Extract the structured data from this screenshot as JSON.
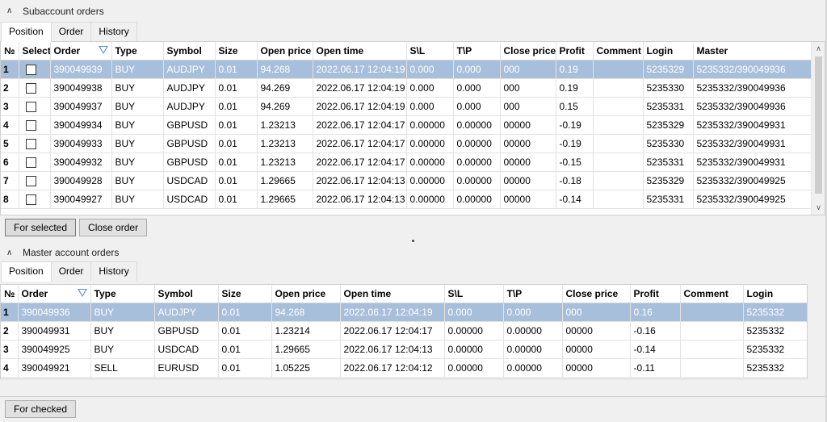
{
  "sub": {
    "header": "Subaccount orders",
    "tabs": [
      "Position",
      "Order",
      "History"
    ],
    "columns": [
      "№",
      "Select",
      "Order",
      "Type",
      "Symbol",
      "Size",
      "Open price",
      "Open time",
      "S\\L",
      "T\\P",
      "Close price",
      "Profit",
      "Comment",
      "Login",
      "Master"
    ],
    "rows": [
      [
        "1",
        "",
        "390049939",
        "BUY",
        "AUDJPY",
        "0.01",
        "94.268",
        "2022.06.17 12:04:19",
        "0.000",
        "0.000",
        "000",
        "0.19",
        "",
        "5235329",
        "5235332/390049936"
      ],
      [
        "2",
        "",
        "390049938",
        "BUY",
        "AUDJPY",
        "0.01",
        "94.269",
        "2022.06.17 12:04:19",
        "0.000",
        "0.000",
        "000",
        "0.19",
        "",
        "5235330",
        "5235332/390049936"
      ],
      [
        "3",
        "",
        "390049937",
        "BUY",
        "AUDJPY",
        "0.01",
        "94.269",
        "2022.06.17 12:04:19",
        "0.000",
        "0.000",
        "000",
        "0.15",
        "",
        "5235331",
        "5235332/390049936"
      ],
      [
        "4",
        "",
        "390049934",
        "BUY",
        "GBPUSD",
        "0.01",
        "1.23213",
        "2022.06.17 12:04:17",
        "0.00000",
        "0.00000",
        "00000",
        "-0.19",
        "",
        "5235329",
        "5235332/390049931"
      ],
      [
        "5",
        "",
        "390049933",
        "BUY",
        "GBPUSD",
        "0.01",
        "1.23213",
        "2022.06.17 12:04:17",
        "0.00000",
        "0.00000",
        "00000",
        "-0.19",
        "",
        "5235330",
        "5235332/390049931"
      ],
      [
        "6",
        "",
        "390049932",
        "BUY",
        "GBPUSD",
        "0.01",
        "1.23213",
        "2022.06.17 12:04:17",
        "0.00000",
        "0.00000",
        "00000",
        "-0.15",
        "",
        "5235331",
        "5235332/390049931"
      ],
      [
        "7",
        "",
        "390049928",
        "BUY",
        "USDCAD",
        "0.01",
        "1.29665",
        "2022.06.17 12:04:13",
        "0.00000",
        "0.00000",
        "00000",
        "-0.18",
        "",
        "5235329",
        "5235332/390049925"
      ],
      [
        "8",
        "",
        "390049927",
        "BUY",
        "USDCAD",
        "0.01",
        "1.29665",
        "2022.06.17 12:04:13",
        "0.00000",
        "0.00000",
        "00000",
        "-0.14",
        "",
        "5235331",
        "5235332/390049925"
      ]
    ],
    "buttons": {
      "for_selected": "For selected",
      "close_order": "Close order"
    }
  },
  "master": {
    "header": "Master account orders",
    "tabs": [
      "Position",
      "Order",
      "History"
    ],
    "columns": [
      "№",
      "Order",
      "Type",
      "Symbol",
      "Size",
      "Open price",
      "Open time",
      "S\\L",
      "T\\P",
      "Close price",
      "Profit",
      "Comment",
      "Login"
    ],
    "rows": [
      [
        "1",
        "390049936",
        "BUY",
        "AUDJPY",
        "0.01",
        "94.268",
        "2022.06.17 12:04:19",
        "0.000",
        "0.000",
        "000",
        "0.16",
        "",
        "5235332"
      ],
      [
        "2",
        "390049931",
        "BUY",
        "GBPUSD",
        "0.01",
        "1.23214",
        "2022.06.17 12:04:17",
        "0.00000",
        "0.00000",
        "00000",
        "-0.16",
        "",
        "5235332"
      ],
      [
        "3",
        "390049925",
        "BUY",
        "USDCAD",
        "0.01",
        "1.29665",
        "2022.06.17 12:04:13",
        "0.00000",
        "0.00000",
        "00000",
        "-0.14",
        "",
        "5235332"
      ],
      [
        "4",
        "390049921",
        "SELL",
        "EURUSD",
        "0.01",
        "1.05225",
        "2022.06.17 12:04:12",
        "0.00000",
        "0.00000",
        "00000",
        "-0.11",
        "",
        "5235332"
      ]
    ],
    "buttons": {
      "for_checked": "For checked"
    }
  },
  "icons": {
    "collapse": "chevron-up-icon",
    "sort": "sort-descending-icon"
  },
  "colors": {
    "selected_row": "#a8bfdb",
    "sort_arrow": "#5b8fd1"
  }
}
